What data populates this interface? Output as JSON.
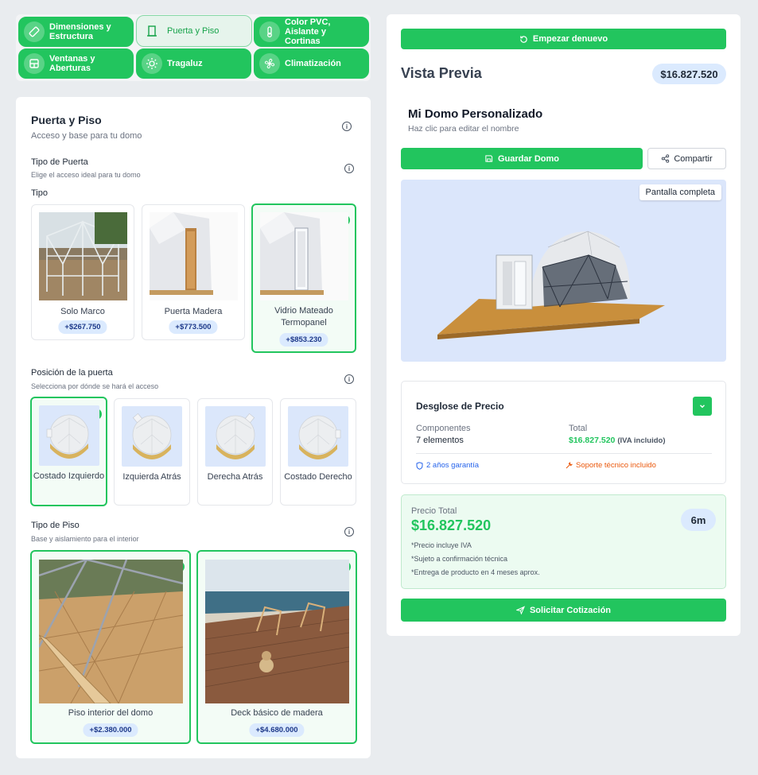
{
  "nav": [
    {
      "label": "Dimensiones y Estructura",
      "icon": "ruler-icon",
      "active": false
    },
    {
      "label": "Puerta y Piso",
      "icon": "door-icon",
      "active": true
    },
    {
      "label": "Color PVC, Aislante y Cortinas",
      "icon": "thermometer-icon",
      "active": false
    },
    {
      "label": "Ventanas y Aberturas",
      "icon": "window-icon",
      "active": false
    },
    {
      "label": "Tragaluz",
      "icon": "sun-icon",
      "active": false
    },
    {
      "label": "Climatización",
      "icon": "fan-icon",
      "active": false
    }
  ],
  "section": {
    "title": "Puerta y Piso",
    "subtitle": "Acceso y base para tu domo"
  },
  "door_type": {
    "title": "Tipo de Puerta",
    "subtitle": "Elige el acceso ideal para tu domo",
    "label": "Tipo",
    "options": [
      {
        "label": "Solo Marco",
        "price": "+$267.750",
        "selected": false
      },
      {
        "label": "Puerta Madera",
        "price": "+$773.500",
        "selected": false
      },
      {
        "label": "Vidrio Mateado Termopanel",
        "price": "+$853.230",
        "selected": true
      }
    ]
  },
  "door_position": {
    "title": "Posición de la puerta",
    "subtitle": "Selecciona por dónde se hará el acceso",
    "options": [
      {
        "label": "Costado Izquierdo",
        "selected": true
      },
      {
        "label": "Izquierda Atrás",
        "selected": false
      },
      {
        "label": "Derecha Atrás",
        "selected": false
      },
      {
        "label": "Costado Derecho",
        "selected": false
      }
    ]
  },
  "floor_type": {
    "title": "Tipo de Piso",
    "subtitle": "Base y aislamiento para el interior",
    "options": [
      {
        "label": "Piso interior del domo",
        "price": "+$2.380.000",
        "selected": true
      },
      {
        "label": "Deck básico de madera",
        "price": "+$4.680.000",
        "selected": true
      }
    ]
  },
  "preview": {
    "restart_label": "Empezar denuevo",
    "title": "Vista Previa",
    "price": "$16.827.520",
    "dome_name": "Mi Domo Personalizado",
    "dome_hint": "Haz clic para editar el nombre",
    "save_label": "Guardar Domo",
    "share_label": "Compartir",
    "fullscreen_label": "Pantalla completa"
  },
  "breakdown": {
    "title": "Desglose de Precio",
    "components_label": "Componentes",
    "components_value": "7 elementos",
    "total_label": "Total",
    "total_value": "$16.827.520",
    "total_note": "(IVA incluido)",
    "warranty": "2 años garantía",
    "support": "Soporte técnico incluido"
  },
  "total": {
    "label": "Precio Total",
    "value": "$16.827.520",
    "badge": "6m",
    "notes": [
      "*Precio incluye IVA",
      "*Sujeto a confirmación técnica",
      "*Entrega de producto en 4 meses aprox."
    ]
  },
  "quote_label": "Solicitar Cotización",
  "colors": {
    "accent": "#22c55e",
    "blue": "#2563eb",
    "orange": "#ea580c"
  }
}
